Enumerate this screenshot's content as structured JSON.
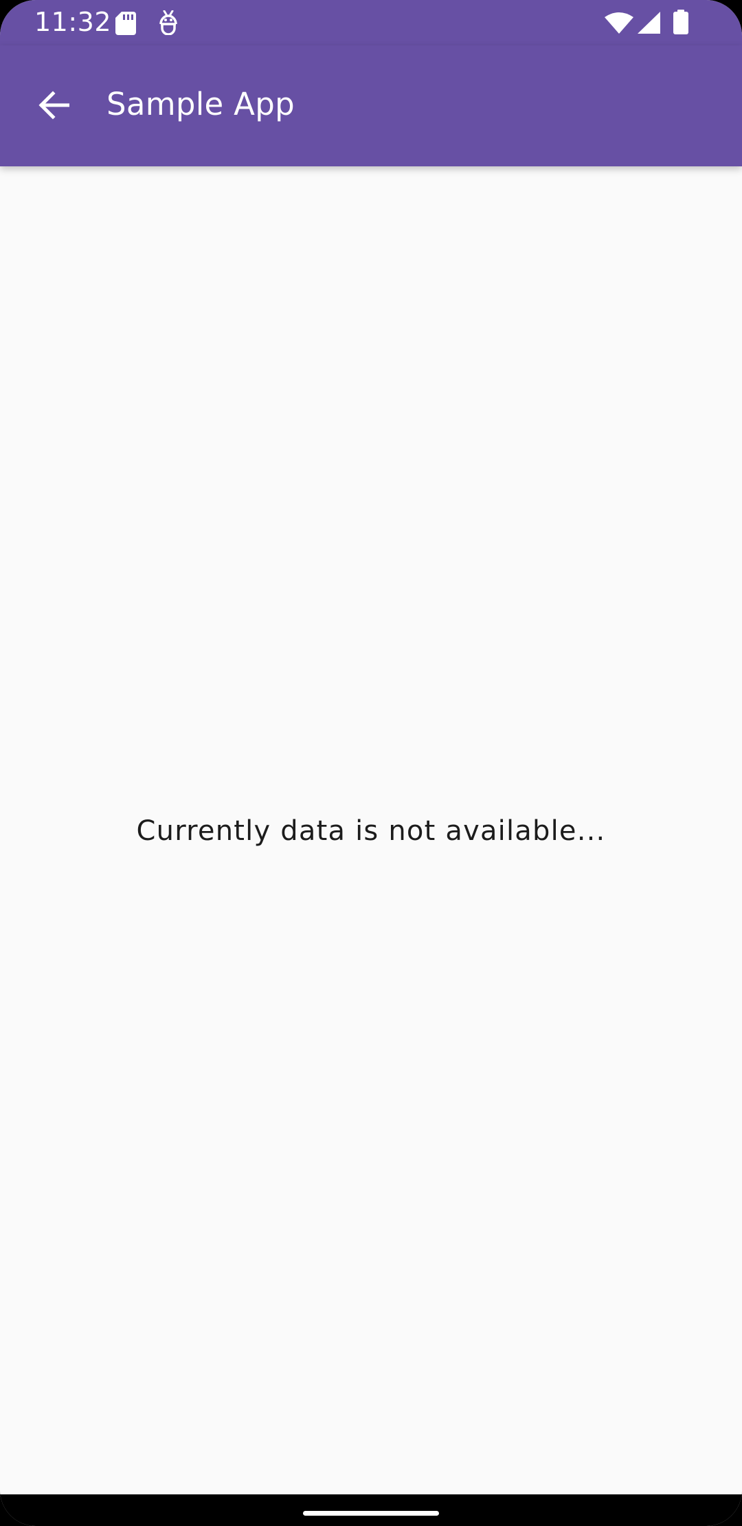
{
  "status_bar": {
    "time": "11:32",
    "icons": [
      "sd-card-icon",
      "robot-face-icon",
      "wifi-icon",
      "cellular-signal-icon",
      "battery-icon"
    ],
    "background": "#6750a4"
  },
  "app_bar": {
    "title": "Sample App",
    "back_icon": "arrow-back-icon",
    "background": "#6750a4"
  },
  "content": {
    "message": "Currently data is not available...",
    "background": "#fafafa"
  },
  "nav_bar": {
    "type": "gesture-navigation"
  }
}
